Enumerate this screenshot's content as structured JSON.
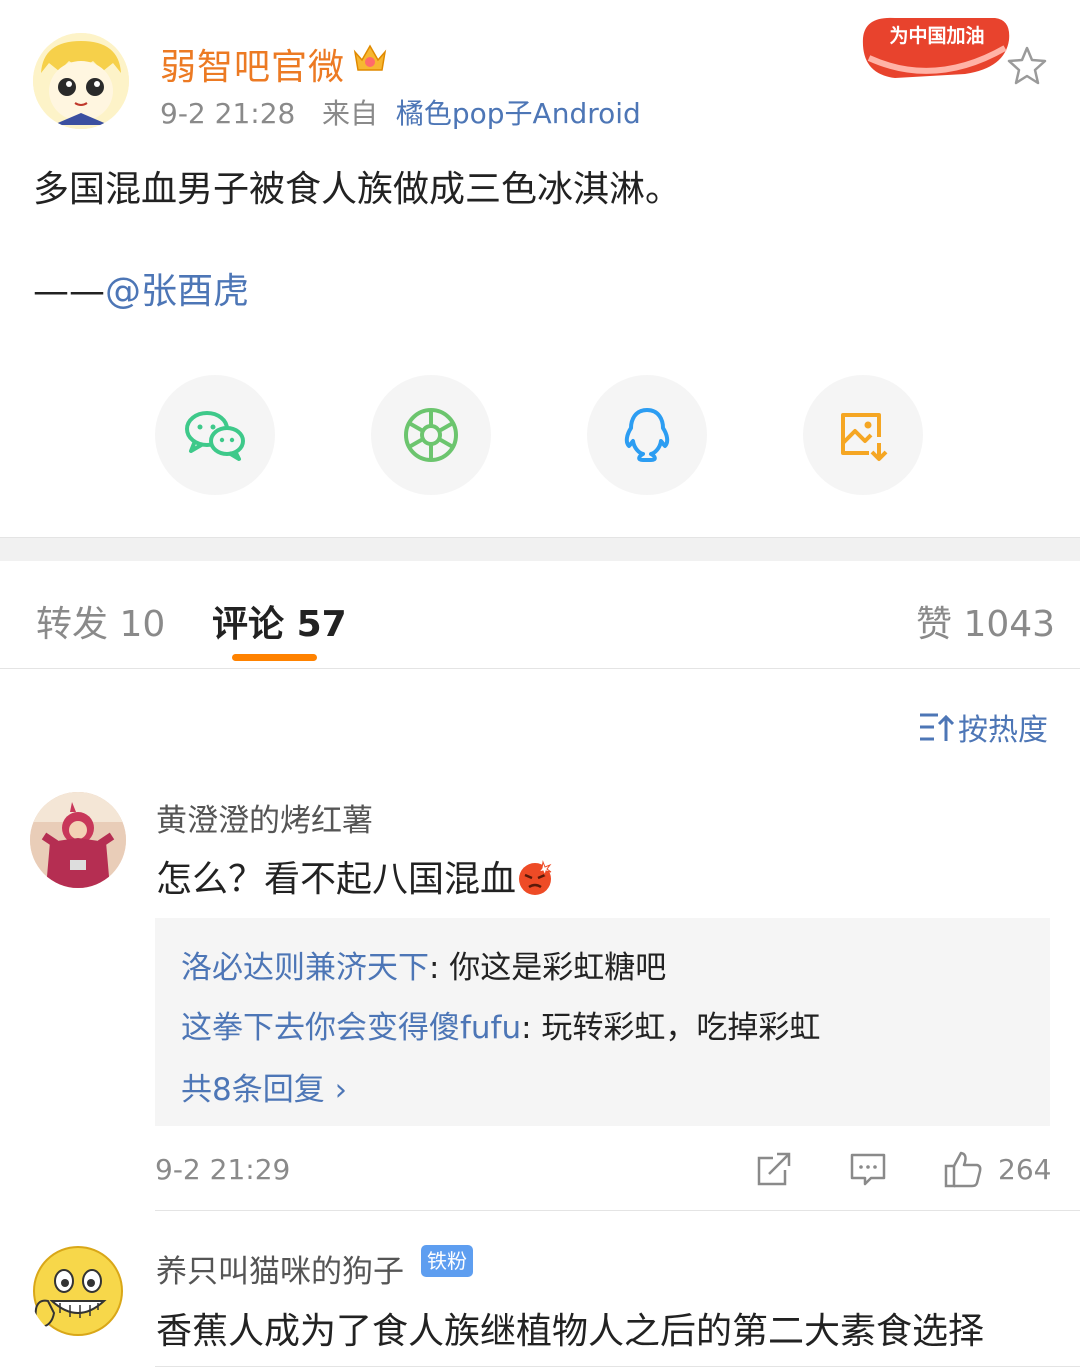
{
  "post": {
    "author": "弱智吧官微",
    "time": "9-2 21:28",
    "from_label": "来自",
    "source": "橘色pop子Android",
    "badge_text": "为中国加油",
    "text": "多国混血男子被食人族做成三色冰淇淋。",
    "sign_prefix": "——",
    "sign_mention": "@张酉虎"
  },
  "share": [
    "wechat-icon",
    "moments-icon",
    "qq-icon",
    "save-image-icon"
  ],
  "tabs": {
    "repost_label": "转发",
    "repost_count": "10",
    "comment_label": "评论",
    "comment_count": "57",
    "like_label": "赞",
    "like_count": "1043"
  },
  "sort_label": "按热度",
  "comments": [
    {
      "name": "黄澄澄的烤红薯",
      "text": "怎么？看不起八国混血",
      "replies": [
        {
          "who": "洛必达则兼济天下",
          "text": ": 你这是彩虹糖吧"
        },
        {
          "who": "这拳下去你会变得傻fufu",
          "text": ": 玩转彩虹，吃掉彩虹"
        }
      ],
      "more": "共8条回复 ›",
      "time": "9-2 21:29",
      "likes": "264"
    },
    {
      "name": "养只叫猫咪的狗子",
      "badge": "铁粉",
      "text": "香蕉人成为了食人族继植物人之后的第二大素食选择"
    }
  ],
  "colors": {
    "accent": "#ff8200",
    "link": "#4d76b6",
    "author": "#ec7a23"
  }
}
